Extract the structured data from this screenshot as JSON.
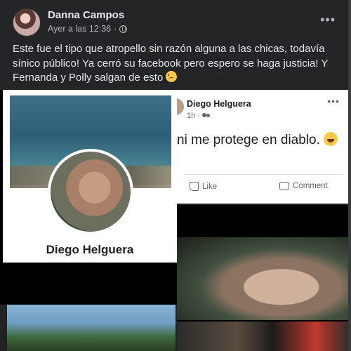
{
  "post": {
    "author": "Danna Campos",
    "timestamp": "Ayer a las 12:36",
    "privacy_icon": "globe-icon",
    "more_label": "•••",
    "caption": "Este fue el tipo que atropello sin razón alguna a las chicas, todavía sínico público! Ya cerró su facebook pero espero se haga justicia! Y Fernanda y Polly salgan de esto",
    "caption_emoji": "disappointed-face-emoji"
  },
  "photos": {
    "profile_name": "Diego Helguera",
    "embedded_post": {
      "author": "Diego Helguera",
      "time": "1h",
      "audience_icon": "friends-icon",
      "more_label": "•••",
      "text": "ni me protege en diablo.",
      "emoji": "grinning-squinting-face-emoji",
      "like_label": "Like",
      "comment_label": "Comment"
    }
  },
  "colors": {
    "background": "#242526",
    "text_primary": "#e4e6eb",
    "text_secondary": "#b0b3b8"
  }
}
